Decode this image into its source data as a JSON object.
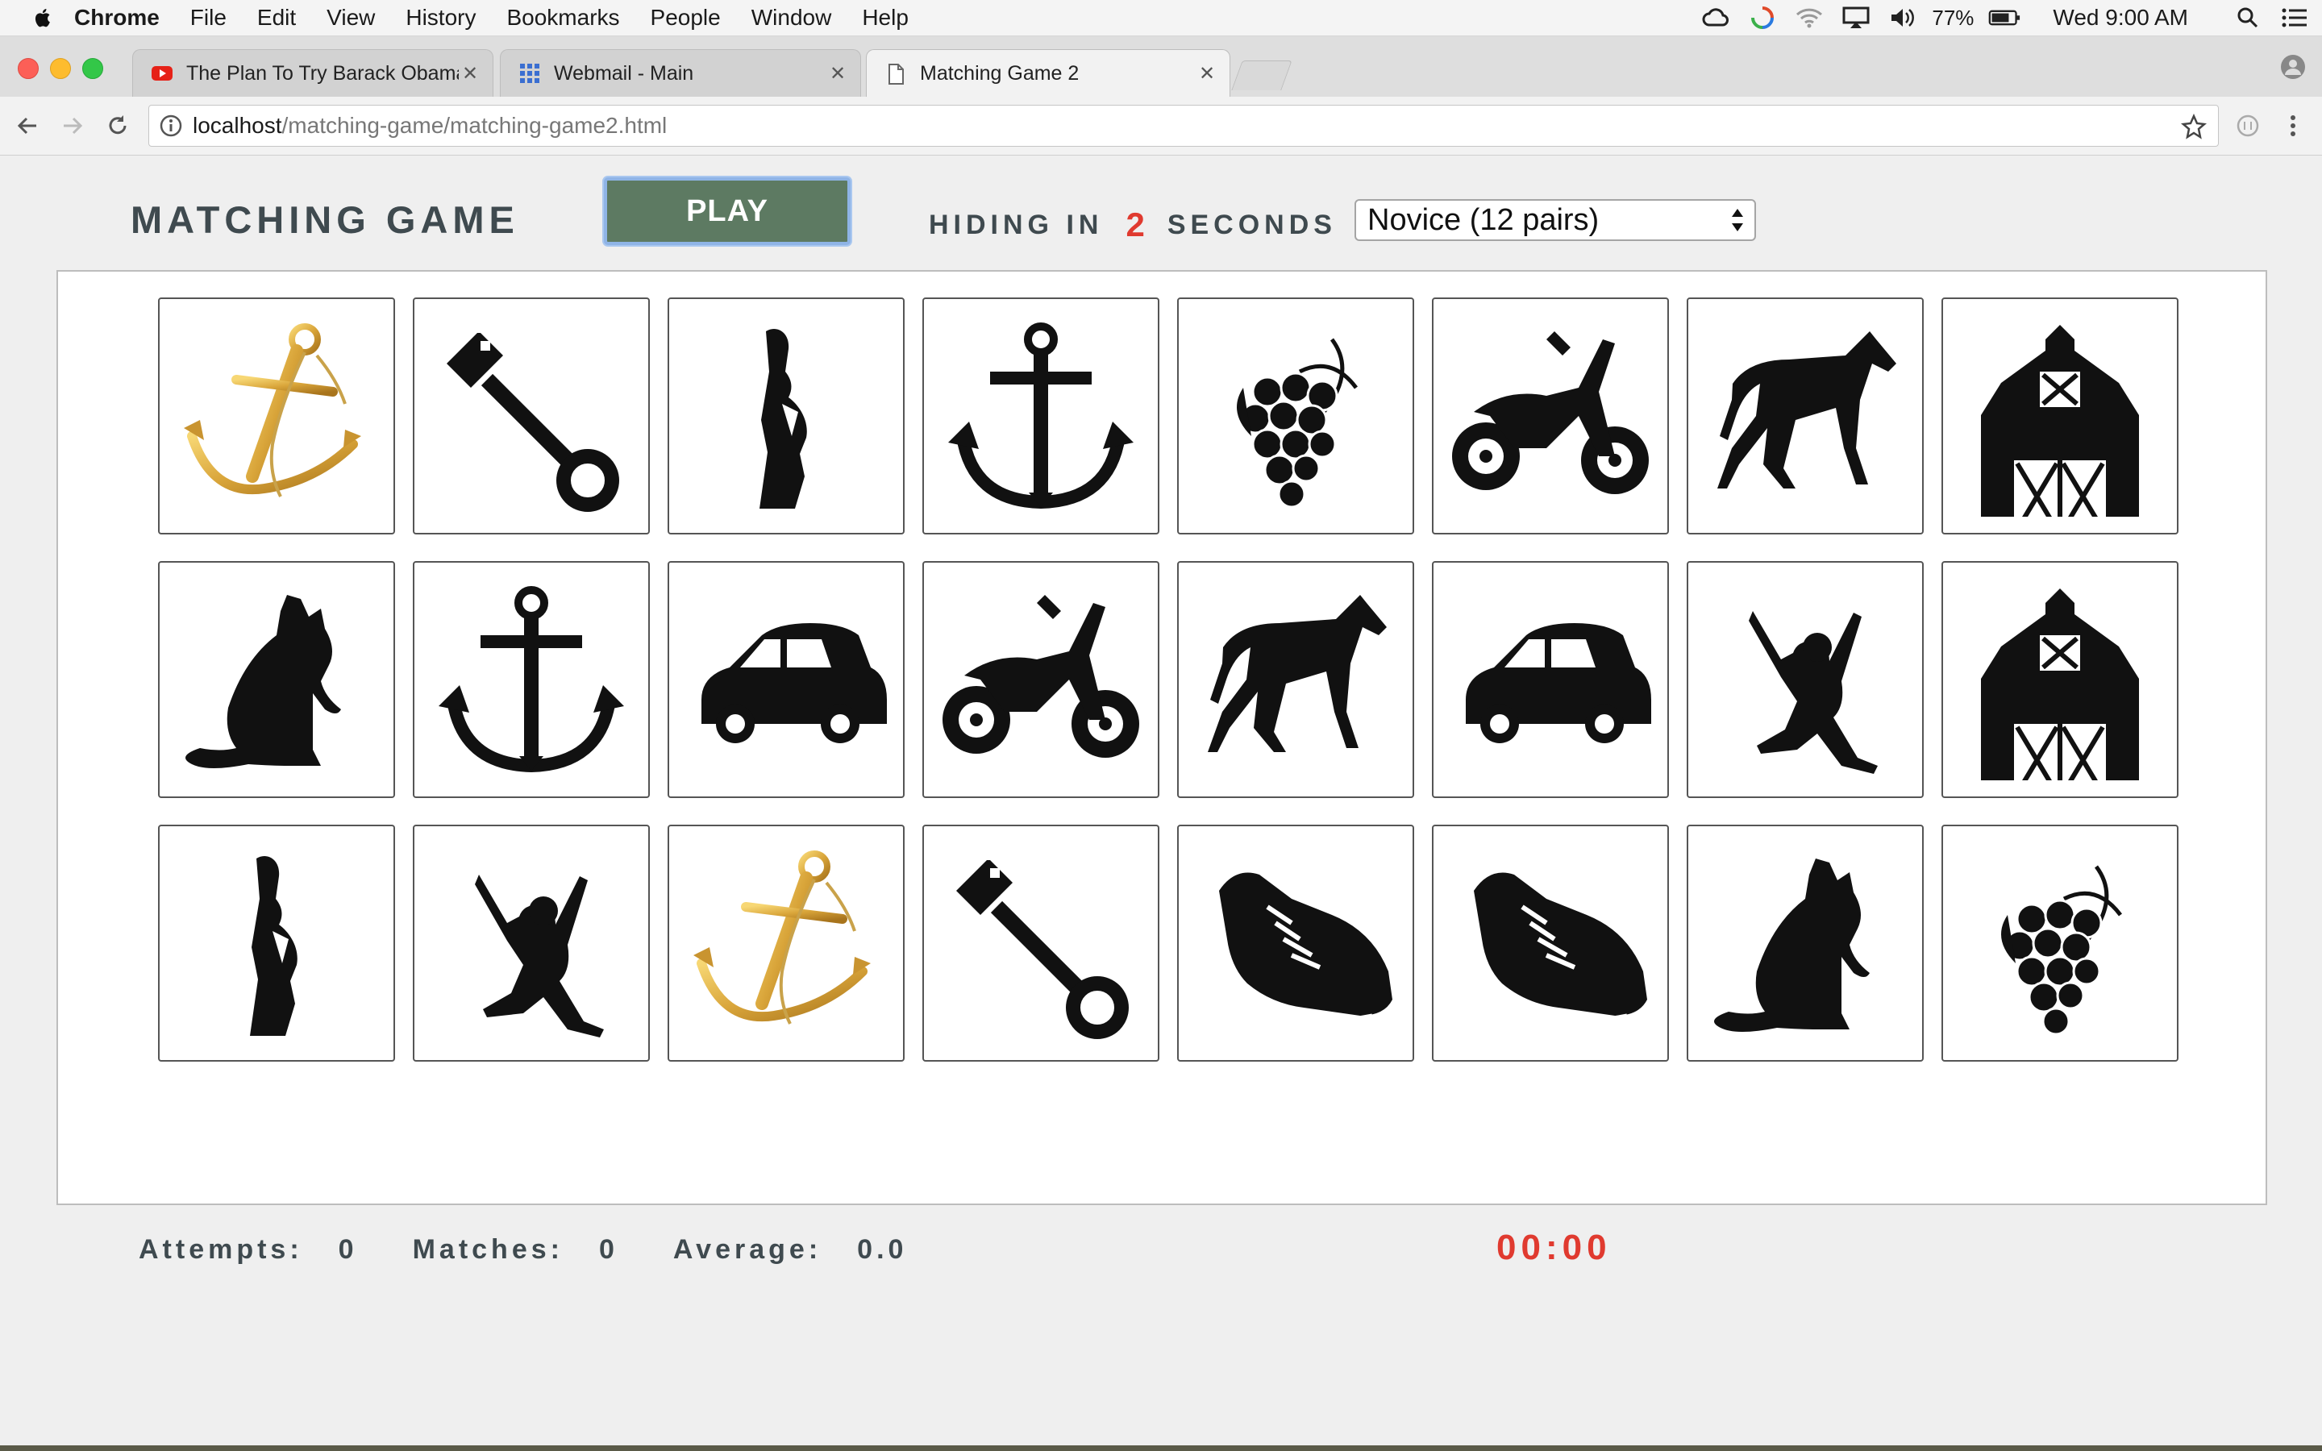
{
  "menubar": {
    "app": "Chrome",
    "items": [
      "File",
      "Edit",
      "View",
      "History",
      "Bookmarks",
      "People",
      "Window",
      "Help"
    ],
    "battery": "77%",
    "clock": "Wed 9:00 AM"
  },
  "tabs": [
    {
      "title": "The Plan To Try Barack Obama",
      "favicon": "youtube-icon"
    },
    {
      "title": "Webmail - Main",
      "favicon": "grid-icon"
    },
    {
      "title": "Matching Game 2",
      "favicon": "page-icon"
    }
  ],
  "address": {
    "host": "localhost",
    "path": "/matching-game/matching-game2.html"
  },
  "game": {
    "title": "MATCHING GAME",
    "play_label": "PLAY",
    "hiding_prefix": "HIDING IN",
    "hiding_count": "2",
    "hiding_suffix": "SECONDS",
    "difficulty": "Novice (12 pairs)",
    "cards": [
      [
        "golden-anchor",
        "key",
        "person-silhouette",
        "anchor",
        "grapes",
        "motorcycle",
        "horse",
        "barn"
      ],
      [
        "cat",
        "anchor",
        "car",
        "motorcycle",
        "horse",
        "car",
        "jumping-person",
        "barn"
      ],
      [
        "person-silhouette",
        "jumping-person",
        "golden-anchor",
        "key",
        "sneaker",
        "sneaker",
        "cat",
        "grapes"
      ]
    ]
  },
  "stats": {
    "attempts_label": "Attempts:",
    "attempts": "0",
    "matches_label": "Matches:",
    "matches": "0",
    "average_label": "Average:",
    "average": "0.0",
    "timer": "00:00"
  },
  "colors": {
    "play_button": "#5d7a62",
    "accent_red": "#e03a2f",
    "heading": "#3f4a4f"
  }
}
